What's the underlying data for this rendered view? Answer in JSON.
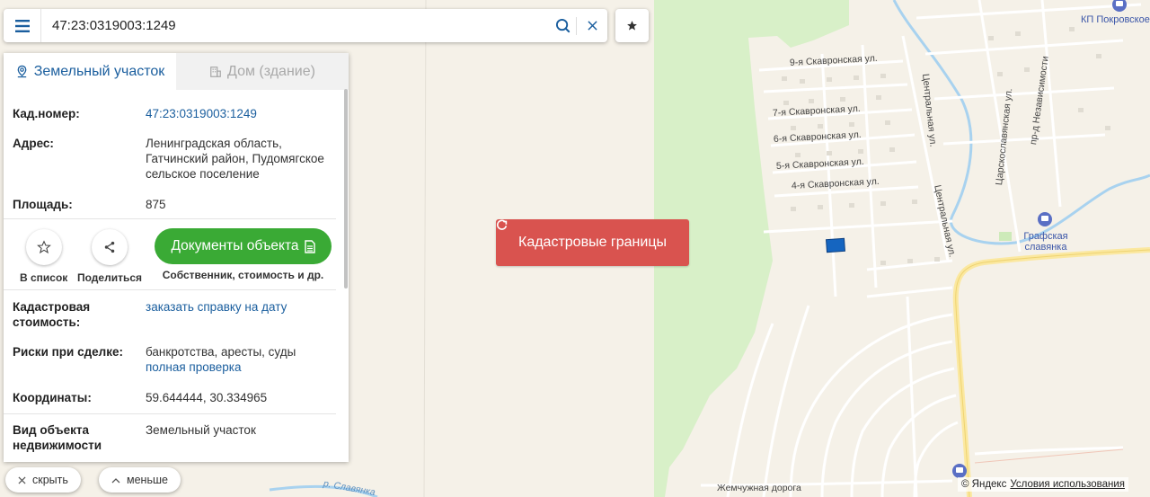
{
  "search": {
    "value": "47:23:0319003:1249"
  },
  "tabs": [
    {
      "label": "Земельный участок",
      "icon": "map-pin-icon"
    },
    {
      "label": "Дом (здание)",
      "icon": "building-icon"
    }
  ],
  "fields": {
    "cad_number": {
      "label": "Кад.номер:",
      "value": "47:23:0319003:1249"
    },
    "address": {
      "label": "Адрес:",
      "lines": [
        "Ленинградская область,",
        "Гатчинский район, Пудомягское",
        "сельское поселение"
      ]
    },
    "area": {
      "label": "Площадь:",
      "value": "875"
    },
    "cad_cost": {
      "label_lines": [
        "Кадастровая",
        "стоимость:"
      ],
      "link": "заказать справку на дату"
    },
    "risks": {
      "label": "Риски при сделке:",
      "value": "банкротства, аресты, суды",
      "link": "полная проверка"
    },
    "coords": {
      "label": "Координаты:",
      "value": "59.644444, 30.334965"
    },
    "object_type": {
      "label_lines": [
        "Вид объекта",
        "недвижимости"
      ],
      "value": "Земельный участок"
    }
  },
  "actions": {
    "add_to_list": "В список",
    "share": "Поделиться",
    "documents": "Документы объекта",
    "documents_sub": "Собственник, стоимость и др."
  },
  "bottom": {
    "hide": "скрыть",
    "less": "меньше"
  },
  "map": {
    "center_button": "Кадастровые границы",
    "streets": [
      "9-я Скавронская ул.",
      "7-я Скавронская ул.",
      "6-я Скавронская ул.",
      "5-я Скавронская ул.",
      "4-я Скавронская ул.",
      "Центральная ул.",
      "Центральная ул.",
      "Царскославянская ул.",
      "пр-д Независимости",
      "р. Славянка",
      "Жемчужная дорога"
    ],
    "pois": [
      {
        "name": "КП Покровское",
        "icon": "poi-icon"
      },
      {
        "name": "Графская славянка",
        "icon": "poi-icon"
      },
      {
        "name": "",
        "icon": "poi-icon"
      }
    ],
    "copyright": "© Яндекс",
    "terms": "Условия использования"
  },
  "colors": {
    "accent": "#1a5e9e",
    "green": "#3aaa35",
    "red": "#d9534f",
    "map_bg": "#f5f1e8",
    "forest": "#d8f0c8",
    "water": "#a8d2ef",
    "parcel": "#1565c0"
  }
}
